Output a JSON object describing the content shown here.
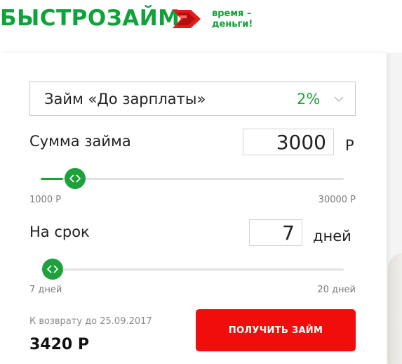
{
  "brand": {
    "name": "БЫСТРОЗАЙМ",
    "tagline_line1": "время –",
    "tagline_line2": "деньги!",
    "primary_color": "#10a23a",
    "mark_color": "#f20d0d",
    "mark_icon": "red-arrow-card-icon"
  },
  "loan_type": {
    "selected": "Займ «До зарплаты»",
    "rate": "2%",
    "chevron_icon": "chevron-down-icon"
  },
  "amount": {
    "label": "Сумма займа",
    "value": "3000",
    "unit": "Р",
    "min_label": "1000 Р",
    "max_label": "30000 Р",
    "fraction": 0.074
  },
  "term": {
    "label": "На срок",
    "value": "7",
    "unit": "дней",
    "min_label": "7 дней",
    "max_label": "20 дней",
    "fraction": 0.0
  },
  "result": {
    "return_label": "К возврату до 25.09.2017",
    "return_amount": "3420 Р"
  },
  "cta": {
    "label": "ПОЛУЧИТЬ ЗАЙМ",
    "color": "#f20d0d"
  },
  "accent_green": "#1ea13c"
}
